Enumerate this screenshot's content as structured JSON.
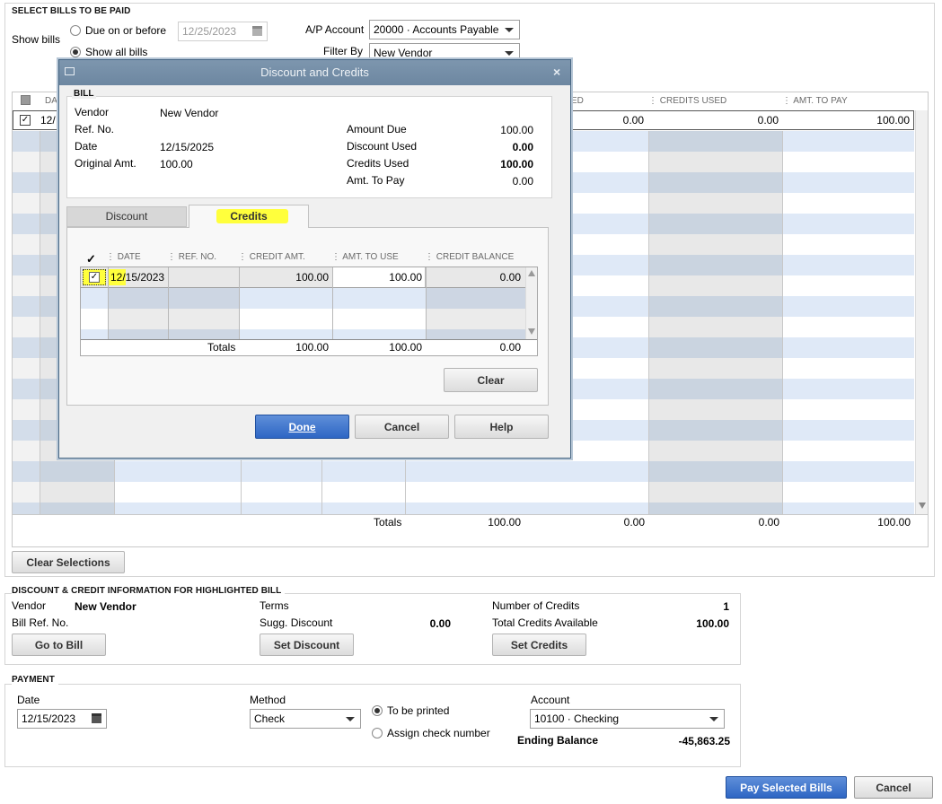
{
  "select_bills": {
    "section_title": "SELECT BILLS TO BE PAID",
    "show_bills_label": "Show bills",
    "due_on_or_before_label": "Due on or before",
    "due_date": "12/25/2023",
    "show_all_bills_label": "Show all bills",
    "ap_account_label": "A/P Account",
    "ap_account_value": "20000 · Accounts Payable",
    "filter_by_label": "Filter By",
    "filter_by_value": "New Vendor"
  },
  "bills_table": {
    "headers": [
      "DATE",
      "CREDITS USED",
      "AMT. TO PAY"
    ],
    "header_partial": "ED",
    "row": {
      "date": "12/",
      "discount_used": "0.00",
      "credits_used": "0.00",
      "amt_to_pay": "100.00"
    },
    "totals_label": "Totals",
    "totals": [
      "100.00",
      "0.00",
      "0.00",
      "100.00"
    ],
    "clear_selections_label": "Clear Selections"
  },
  "discount_credit_info": {
    "section_title": "DISCOUNT & CREDIT INFORMATION FOR HIGHLIGHTED BILL",
    "vendor_label": "Vendor",
    "vendor_value": "New Vendor",
    "bill_ref_label": "Bill Ref. No.",
    "terms_label": "Terms",
    "sugg_discount_label": "Sugg. Discount",
    "sugg_discount_value": "0.00",
    "num_credits_label": "Number of Credits",
    "num_credits_value": "1",
    "total_credits_label": "Total Credits Available",
    "total_credits_value": "100.00",
    "go_to_bill": "Go to Bill",
    "set_discount": "Set Discount",
    "set_credits": "Set Credits"
  },
  "payment": {
    "section_title": "PAYMENT",
    "date_label": "Date",
    "date_value": "12/15/2023",
    "method_label": "Method",
    "method_value": "Check",
    "to_be_printed": "To be printed",
    "assign_check_number": "Assign check number",
    "account_label": "Account",
    "account_value": "10100 · Checking",
    "ending_balance_label": "Ending Balance",
    "ending_balance_value": "-45,863.25"
  },
  "footer": {
    "pay_selected": "Pay Selected Bills",
    "cancel": "Cancel"
  },
  "dialog": {
    "title": "Discount and Credits",
    "bill_section": "BILL",
    "vendor_label": "Vendor",
    "vendor_value": "New Vendor",
    "ref_no_label": "Ref. No.",
    "date_label": "Date",
    "date_value": "12/15/2025",
    "original_amt_label": "Original Amt.",
    "original_amt_value": "100.00",
    "amount_due_label": "Amount Due",
    "amount_due_value": "100.00",
    "discount_used_label": "Discount Used",
    "discount_used_value": "0.00",
    "credits_used_label": "Credits Used",
    "credits_used_value": "100.00",
    "amt_to_pay_label": "Amt. To Pay",
    "amt_to_pay_value": "0.00",
    "tabs": [
      "Discount",
      "Credits"
    ],
    "credits_table": {
      "headers": [
        "DATE",
        "REF. NO.",
        "CREDIT AMT.",
        "AMT. TO USE",
        "CREDIT BALANCE"
      ],
      "row": {
        "date": "12/15/2023",
        "ref_no": "",
        "credit_amt": "100.00",
        "amt_to_use": "100.00",
        "credit_balance": "0.00"
      },
      "totals_label": "Totals",
      "totals": [
        "100.00",
        "100.00",
        "0.00"
      ]
    },
    "clear": "Clear",
    "done": "Done",
    "cancel": "Cancel",
    "help": "Help"
  },
  "colors": {
    "highlight_yellow": "#ffff3c",
    "stripe_blue": "#dfe9f7",
    "dialog_title": "#7590ab",
    "primary_button": "#3569c6"
  }
}
